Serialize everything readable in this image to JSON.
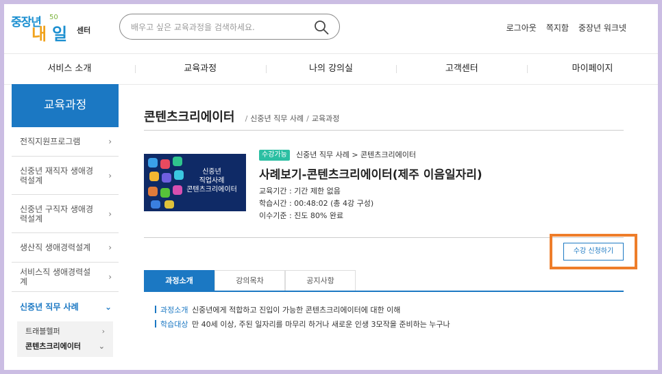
{
  "logo": {
    "line1": "중장년",
    "line2a": "내",
    "line2b": "일",
    "line3": "센터",
    "mark": "50"
  },
  "search": {
    "placeholder": "배우고 싶은 교육과정을 검색하세요."
  },
  "util": [
    "로그아웃",
    "쪽지함",
    "중장년 워크넷"
  ],
  "gnb": [
    "서비스 소개",
    "교육과정",
    "나의 강의실",
    "고객센터",
    "마이페이지"
  ],
  "sidebar": {
    "title": "교육과정",
    "items": [
      {
        "label": "전직지원프로그램",
        "chev": "›"
      },
      {
        "label": "신중년 재직자 생애경력설계",
        "chev": "›"
      },
      {
        "label": "신중년 구직자 생애경력설계",
        "chev": "›"
      },
      {
        "label": "생산직 생애경력설계",
        "chev": "›"
      },
      {
        "label": "서비스직 생애경력설계",
        "chev": "›"
      },
      {
        "label": "신중년 직무 사례",
        "chev": "⌄"
      }
    ],
    "sub": [
      {
        "label": "트래블헬퍼",
        "chev": "›"
      },
      {
        "label": "콘텐츠크리에이터",
        "chev": "⌄"
      }
    ]
  },
  "page": {
    "title": "콘텐츠크리에이터",
    "breadcrumb": [
      "신중년 직무 사례",
      "교육과정"
    ]
  },
  "course": {
    "thumb_lines": [
      "신중년",
      "직업사례",
      "콘텐츠크리에이터"
    ],
    "badge": "수강가능",
    "category": "신중년 직무 사례 > 콘텐츠크리에이터",
    "name": "사례보기-콘텐츠크리에이터(제주 이음일자리)",
    "meta": [
      "교육기간 : 기간 제한 없음",
      "학습시간 : 00:48:02 (총 4강 구성)",
      "이수기준 : 진도 80% 완료"
    ],
    "apply": "수강 신청하기"
  },
  "tabs": [
    "과정소개",
    "강의목차",
    "공지사항"
  ],
  "info": [
    {
      "k": "과정소개",
      "v": "신중년에게 적합하고 진입이 가능한 콘텐츠크리에이터에 대한 이해"
    },
    {
      "k": "학습대상",
      "v": "만 40세 이상, 주된 일자리를 마무리 하거나 새로운 인생 3모작을 준비하는 누구나"
    }
  ],
  "colors": {
    "primary": "#1b78c3",
    "badge": "#2cbfa3",
    "highlight": "#ee7d2a",
    "frame": "#cbbde3"
  }
}
